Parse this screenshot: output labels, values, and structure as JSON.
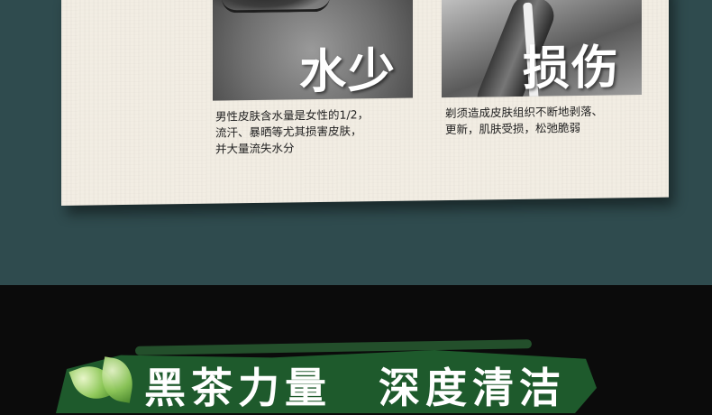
{
  "top": {
    "left_panel": {
      "title": "水少",
      "caption_lines": [
        "男性皮肤含水量是女性的1/2，",
        "流汗、暴晒等尤其损害皮肤，",
        "并大量流失水分"
      ]
    },
    "right_panel": {
      "title": "损伤",
      "caption_lines": [
        "剃须造成皮肤组织不断地剥落、",
        "更新，肌肤受损，松弛脆弱"
      ]
    }
  },
  "bottom": {
    "slogan_part1": "黑茶力量",
    "slogan_part2": "深度清洁"
  },
  "colors": {
    "top_background": "#2f4b4e",
    "paper": "#f2ede3",
    "bottom_background": "#0b0b0b",
    "banner_green": "#1e5a2c"
  }
}
